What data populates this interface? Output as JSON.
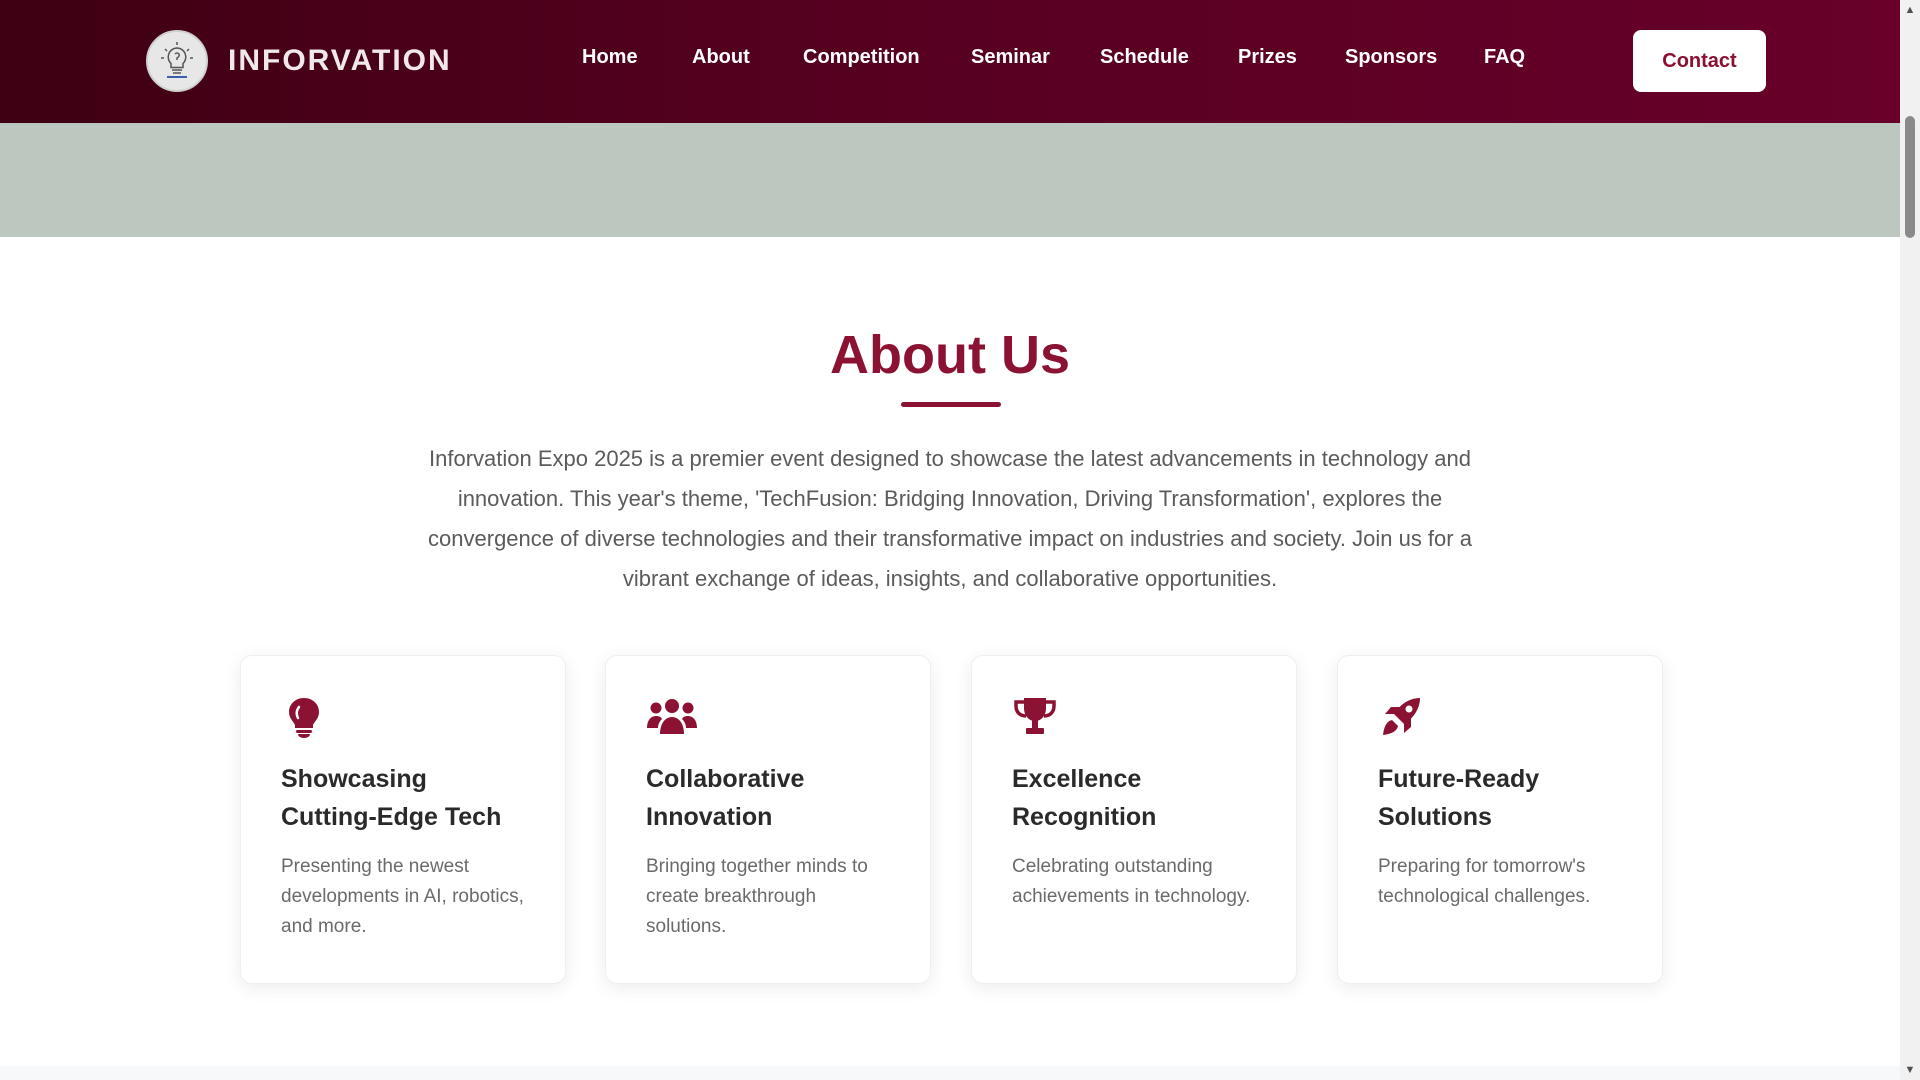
{
  "navbar": {
    "brand_name": "INFORVATION",
    "links": [
      "Home",
      "About",
      "Competition",
      "Seminar",
      "Schedule",
      "Prizes",
      "Sponsors",
      "FAQ"
    ],
    "contact_label": "Contact"
  },
  "about": {
    "title": "About Us",
    "description": "Inforvation Expo 2025 is a premier event designed to showcase the latest advancements in technology and innovation. This year's theme, 'TechFusion: Bridging Innovation, Driving Transformation', explores the convergence of diverse technologies and their transformative impact on industries and society. Join us for a vibrant exchange of ideas, insights, and collaborative opportunities.",
    "cards": [
      {
        "icon": "lightbulb-icon",
        "title": "Showcasing Cutting-Edge Tech",
        "text": "Presenting the newest developments in AI, robotics, and more."
      },
      {
        "icon": "users-icon",
        "title": "Collaborative Innovation",
        "text": "Bringing together minds to create breakthrough solutions."
      },
      {
        "icon": "trophy-icon",
        "title": "Excellence Recognition",
        "text": "Celebrating outstanding achievements in technology."
      },
      {
        "icon": "rocket-icon",
        "title": "Future-Ready Solutions",
        "text": "Preparing for tomorrow's technological challenges."
      }
    ]
  },
  "colors": {
    "nav_gradient_start": "#3e0012",
    "nav_gradient_end": "#68002a",
    "accent": "#8b1232",
    "hero_strip": "#bcc7c0"
  }
}
